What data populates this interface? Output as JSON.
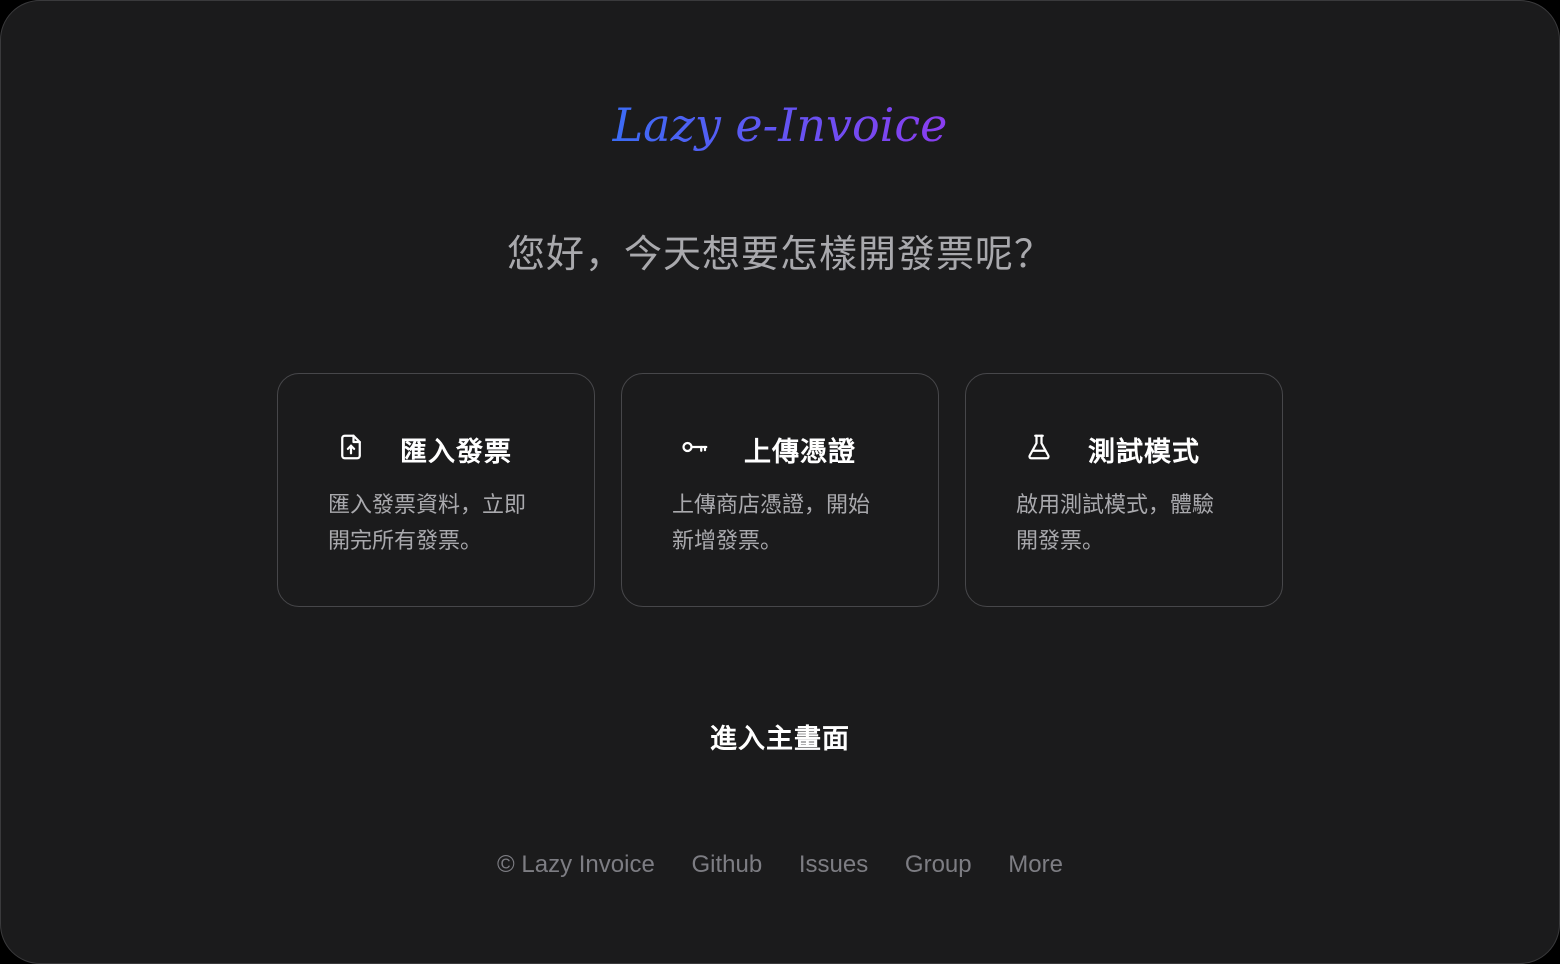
{
  "brand": {
    "logo_text": "Lazy e-Invoice",
    "gradient_start": "#3b6cf5",
    "gradient_end": "#8a3df0"
  },
  "greeting": "您好，今天想要怎樣開發票呢？",
  "cards": [
    {
      "icon": "file-upload-icon",
      "title": "匯入發票",
      "desc_line1": "匯入發票資料，立即",
      "desc_line2": "開完所有發票。"
    },
    {
      "icon": "key-icon",
      "title": "上傳憑證",
      "desc_line1": "上傳商店憑證，開始",
      "desc_line2": "新增發票。"
    },
    {
      "icon": "flask-icon",
      "title": "測試模式",
      "desc_line1": "啟用測試模式，體驗",
      "desc_line2": "開發票。"
    }
  ],
  "enter_main": "進入主畫面",
  "footer": {
    "copyright": "© Lazy Invoice",
    "links": [
      "Github",
      "Issues",
      "Group",
      "More"
    ]
  },
  "colors": {
    "background": "#1b1b1c",
    "card_border": "#47474a",
    "muted_text": "#a9a9ad",
    "footer_text": "#7d7d83"
  }
}
